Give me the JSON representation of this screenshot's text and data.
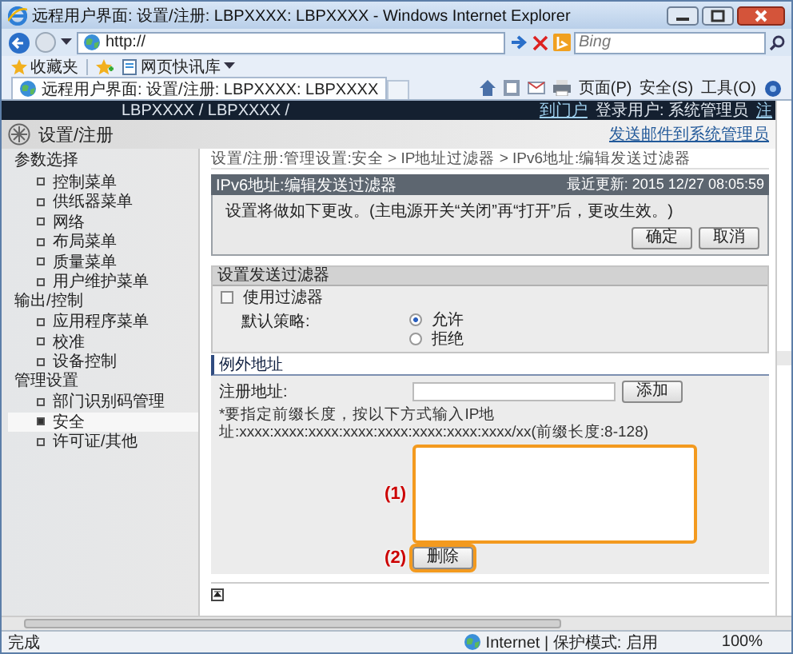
{
  "window": {
    "title": "远程用户界面: 设置/注册: LBPXXXX: LBPXXXX - Windows Internet Explorer"
  },
  "address_bar": {
    "value": "http://"
  },
  "search": {
    "placeholder": "Bing"
  },
  "favorites_bar": {
    "items": [
      "收藏夹",
      "网页快讯库"
    ]
  },
  "tabs": [
    {
      "label": "远程用户界面: 设置/注册: LBPXXXX: LBPXXXX",
      "selected": true
    }
  ],
  "command_bar": {
    "menus": [
      "页面(P)",
      "安全(S)",
      "工具(O)"
    ]
  },
  "page": {
    "device": "LBPXXXX / LBPXXXX /",
    "portal_link": "到门户",
    "login_user": "登录用户: 系统管理员",
    "logout_link": "注",
    "title": "设置/注册",
    "mail_link": "发送邮件到系统管理员"
  },
  "sidebar": {
    "groups": [
      {
        "heading": "参数选择",
        "items": [
          {
            "label": "控制菜单",
            "selected": false
          },
          {
            "label": "供纸器菜单",
            "selected": false
          },
          {
            "label": "网络",
            "selected": false
          },
          {
            "label": "布局菜单",
            "selected": false
          },
          {
            "label": "质量菜单",
            "selected": false
          },
          {
            "label": "用户维护菜单",
            "selected": false
          }
        ]
      },
      {
        "heading": "输出/控制",
        "items": [
          {
            "label": "应用程序菜单",
            "selected": false
          },
          {
            "label": "校准",
            "selected": false
          },
          {
            "label": "设备控制",
            "selected": false
          }
        ]
      },
      {
        "heading": "管理设置",
        "items": [
          {
            "label": "部门识别码管理",
            "selected": false
          },
          {
            "label": "安全",
            "selected": true
          },
          {
            "label": "许可证/其他",
            "selected": false
          }
        ]
      }
    ]
  },
  "breadcrumb": "设置/注册:管理设置:安全 > IP地址过滤器 > IPv6地址:编辑发送过滤器",
  "panel": {
    "title": "IPv6地址:编辑发送过滤器",
    "updated": "最近更新: 2015 12/27 08:05:59",
    "message": "设置将做如下更改。(主电源开关“关闭”再“打开”后，更改生效。)",
    "buttons": [
      "确定",
      "取消"
    ]
  },
  "filter_section": {
    "title": "设置发送过滤器",
    "use_filter": {
      "label": "使用过滤器",
      "checked": false
    },
    "default_policy": {
      "label": "默认策略:",
      "options": [
        {
          "label": "允许",
          "selected": true
        },
        {
          "label": "拒绝",
          "selected": false
        }
      ]
    }
  },
  "exception_section": {
    "title": "例外地址",
    "register_label": "注册地址:",
    "add_button": "添加",
    "note": "*要指定前缀长度，按以下方式输入IP地址:xxxx:xxxx:xxxx:xxxx:xxxx:xxxx:xxxx:xxxx/xx(前缀长度:8-128)",
    "list_callout": "(1)",
    "delete_callout": "(2)",
    "delete_button": "删除"
  },
  "status_bar": {
    "text": "完成",
    "zone": "Internet | 保护模式: 启用",
    "zoom": "100%"
  }
}
